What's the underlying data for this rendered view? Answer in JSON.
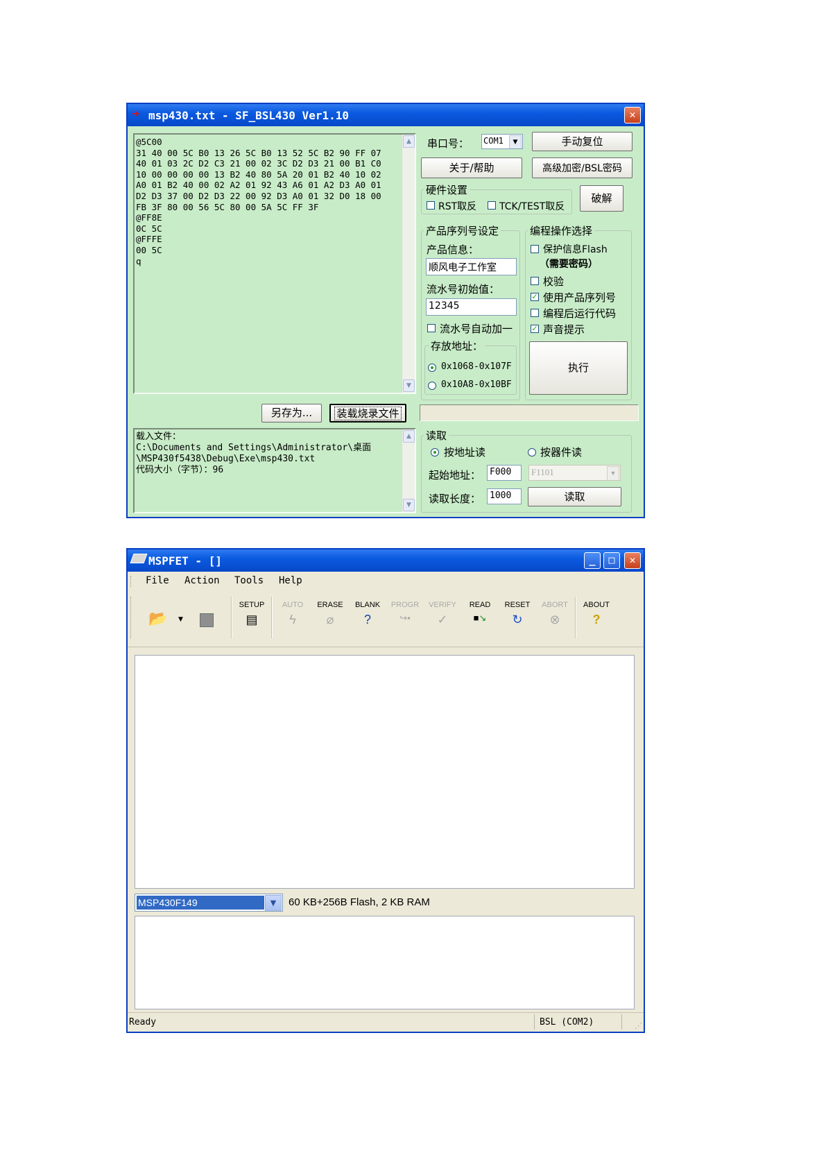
{
  "bsl": {
    "title": "msp430.txt - SF_BSL430 Ver1.10",
    "hex_lines": [
      "@5C00",
      "31 40 00 5C B0 13 26 5C B0 13 52 5C B2 90 FF 07",
      "40 01 03 2C D2 C3 21 00 02 3C D2 D3 21 00 B1 C0",
      "10 00 00 00 00 13 B2 40 80 5A 20 01 B2 40 10 02",
      "A0 01 B2 40 00 02 A2 01 92 43 A6 01 A2 D3 A0 01",
      "D2 D3 37 00 D2 D3 22 00 92 D3 A0 01 32 D0 18 00",
      "FB 3F 80 00 56 5C 80 00 5A 5C FF 3F",
      "@FF8E",
      "0C 5C",
      "@FFFE",
      "00 5C",
      "q"
    ],
    "save_as": "另存为...",
    "load_file": "装载烧录文件",
    "log_lines": [
      "载入文件：",
      "C:\\Documents and Settings\\Administrator\\桌面",
      "\\MSP430f5438\\Debug\\Exe\\msp430.txt",
      "代码大小（字节）：96"
    ],
    "port_label": "串口号：",
    "port_value": "COM1",
    "manual_reset": "手动复位",
    "about_help": "关于/帮助",
    "adv_encrypt": "高级加密/BSL密码",
    "hw_group": "硬件设置",
    "rst_invert": "RST取反",
    "tck_invert": "TCK/TEST取反",
    "crack": "破解",
    "serial_group": "产品序列号设定",
    "product_info_label": "产品信息：",
    "product_info_value": "顺风电子工作室",
    "serial_start_label": "流水号初始值：",
    "serial_start_value": "12345",
    "serial_auto_inc": "流水号自动加一",
    "store_addr_group": "存放地址：",
    "addr_opt1": "0x1068-0x107F",
    "addr_opt2": "0x10A8-0x10BF",
    "prog_group": "编程操作选择",
    "protect_flash": "保护信息Flash",
    "need_password": "（需要密码）",
    "verify": "校验",
    "use_serial": "使用产品序列号",
    "run_after": "编程后运行代码",
    "sound": "声音提示",
    "execute": "执行",
    "read_group": "读取",
    "read_by_addr": "按地址读",
    "read_by_device": "按器件读",
    "start_addr_label": "起始地址：",
    "start_addr_value": "F000",
    "device_value": "F1101",
    "read_len_label": "读取长度：",
    "read_len_value": "1000",
    "read_button": "读取"
  },
  "fet": {
    "title": "MSPFET - []",
    "menu": [
      "File",
      "Action",
      "Tools",
      "Help"
    ],
    "toolbar": [
      "SETUP",
      "AUTO",
      "ERASE",
      "BLANK",
      "PROGR",
      "VERIFY",
      "READ",
      "RESET",
      "ABORT",
      "ABOUT"
    ],
    "device": "MSP430F149",
    "device_info": "60 KB+256B Flash, 2 KB RAM",
    "status_left": "Ready",
    "status_right": "BSL (COM2)"
  },
  "colors": {
    "bsl_bg": "#c8ecc8",
    "fet_bg": "#ece9d8",
    "title_blue": "#0a5ae0"
  }
}
